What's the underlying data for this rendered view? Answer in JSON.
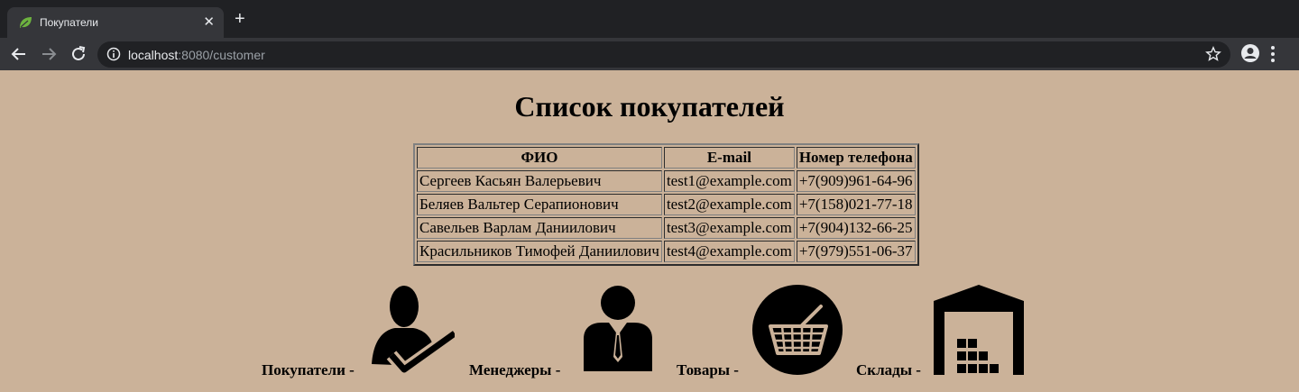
{
  "browser": {
    "tab_title": "Покупатели",
    "url_host": "localhost",
    "url_rest": ":8080/customer"
  },
  "page": {
    "heading": "Список покупателей"
  },
  "table": {
    "headers": [
      "ФИО",
      "E-mail",
      "Номер телефона"
    ],
    "rows": [
      [
        "Сергеев Касьян Валерьевич",
        "test1@example.com",
        "+7(909)961-64-96"
      ],
      [
        "Беляев Вальтер Серапионович",
        "test2@example.com",
        "+7(158)021-77-18"
      ],
      [
        "Савельев Варлам Даниилович",
        "test3@example.com",
        "+7(904)132-66-25"
      ],
      [
        "Красильников Тимофей Даниилович",
        "test4@example.com",
        "+7(979)551-06-37"
      ]
    ]
  },
  "nav": {
    "customers_label": "Покупатели -",
    "customers_icon": "customer-check-icon",
    "managers_label": "Менеджеры -",
    "managers_icon": "manager-icon",
    "products_label": "Товары -",
    "products_icon": "basket-icon",
    "warehouses_label": "Склады -",
    "warehouses_icon": "warehouse-icon"
  }
}
